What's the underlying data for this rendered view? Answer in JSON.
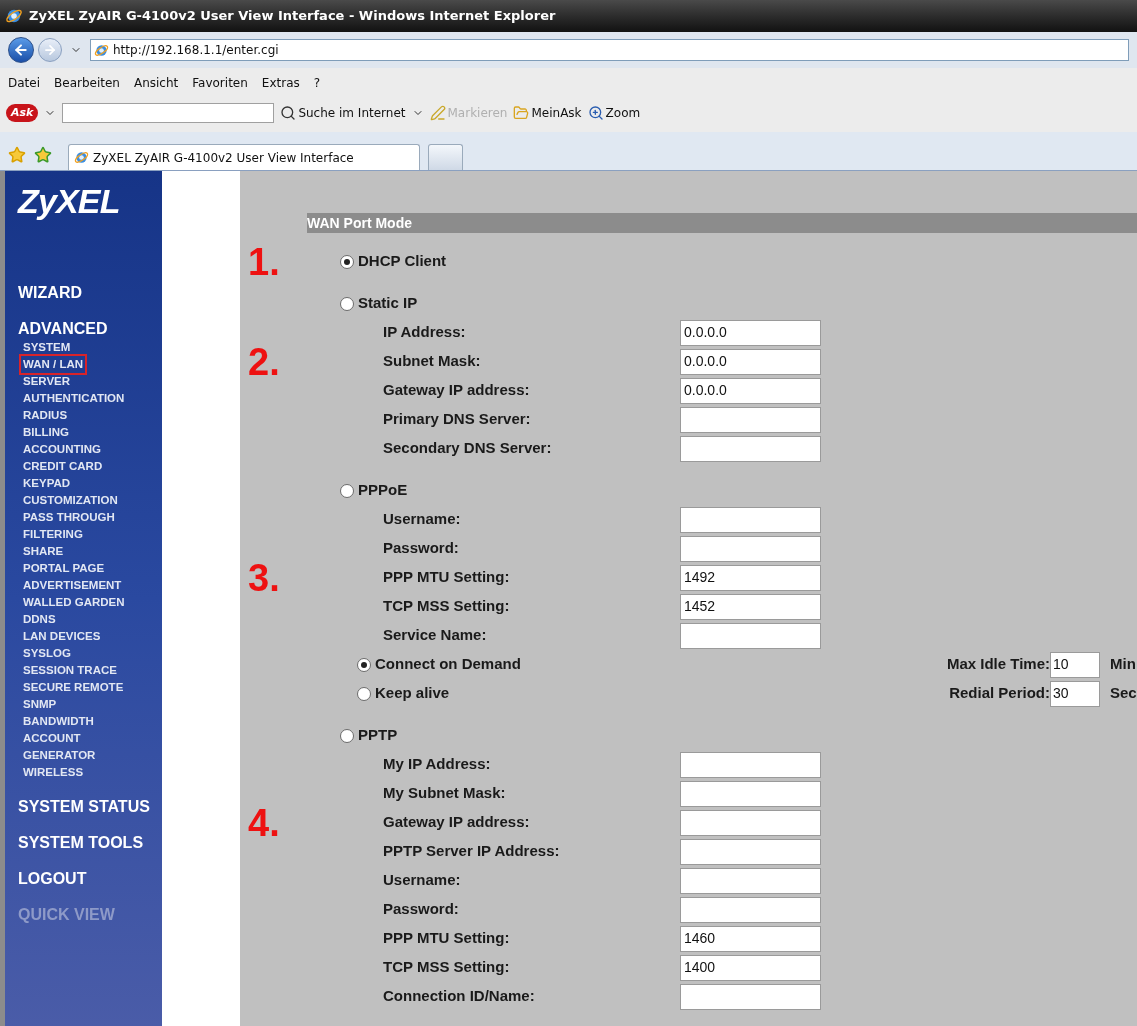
{
  "window": {
    "title": "ZyXEL ZyAIR G-4100v2 User View Interface - Windows Internet Explorer"
  },
  "address_bar": {
    "url": "http://192.168.1.1/enter.cgi"
  },
  "menu": [
    "Datei",
    "Bearbeiten",
    "Ansicht",
    "Favoriten",
    "Extras",
    "?"
  ],
  "ask_toolbar": {
    "logo": "Ask",
    "items": [
      {
        "label": "Suche im Internet",
        "kind": "search",
        "disabled": false
      },
      {
        "label": "Markieren",
        "kind": "pen",
        "disabled": true
      },
      {
        "label": "MeinAsk",
        "kind": "folder",
        "disabled": false
      },
      {
        "label": "Zoom",
        "kind": "zoom",
        "disabled": false
      }
    ]
  },
  "tabs": [
    {
      "label": "ZyXEL ZyAIR G-4100v2 User View Interface",
      "selected": true
    }
  ],
  "sidebar": {
    "logo": "ZyXEL",
    "items": [
      {
        "label": "WIZARD",
        "kind": "heading",
        "selected": false,
        "disabled": false
      },
      {
        "label": "ADVANCED",
        "kind": "heading",
        "selected": false,
        "disabled": false,
        "children": [
          {
            "label": "SYSTEM",
            "selected": false
          },
          {
            "label": "WAN / LAN",
            "selected": true
          },
          {
            "label": "SERVER",
            "selected": false
          },
          {
            "label": "AUTHENTICATION",
            "selected": false
          },
          {
            "label": "RADIUS",
            "selected": false
          },
          {
            "label": "BILLING",
            "selected": false
          },
          {
            "label": "ACCOUNTING",
            "selected": false
          },
          {
            "label": "CREDIT CARD",
            "selected": false
          },
          {
            "label": "KEYPAD",
            "selected": false
          },
          {
            "label": "CUSTOMIZATION",
            "selected": false
          },
          {
            "label": "PASS THROUGH",
            "selected": false
          },
          {
            "label": "FILTERING",
            "selected": false
          },
          {
            "label": "SHARE",
            "selected": false
          },
          {
            "label": "PORTAL PAGE",
            "selected": false
          },
          {
            "label": "ADVERTISEMENT",
            "selected": false
          },
          {
            "label": "WALLED GARDEN",
            "selected": false
          },
          {
            "label": "DDNS",
            "selected": false
          },
          {
            "label": "LAN DEVICES",
            "selected": false
          },
          {
            "label": "SYSLOG",
            "selected": false
          },
          {
            "label": "SESSION TRACE",
            "selected": false
          },
          {
            "label": "SECURE REMOTE",
            "selected": false
          },
          {
            "label": "SNMP",
            "selected": false
          },
          {
            "label": "BANDWIDTH",
            "selected": false
          },
          {
            "label": "ACCOUNT",
            "selected": false
          },
          {
            "label": "GENERATOR",
            "selected": false
          },
          {
            "label": "WIRELESS",
            "selected": false
          }
        ]
      },
      {
        "label": "SYSTEM STATUS",
        "kind": "heading",
        "selected": false,
        "disabled": false
      },
      {
        "label": "SYSTEM TOOLS",
        "kind": "heading",
        "selected": false,
        "disabled": false
      },
      {
        "label": "LOGOUT",
        "kind": "heading",
        "selected": false,
        "disabled": false
      },
      {
        "label": "QUICK VIEW",
        "kind": "heading",
        "selected": false,
        "disabled": true
      }
    ]
  },
  "wan_port_mode": {
    "title": "WAN Port Mode",
    "options": [
      {
        "label": "DHCP Client",
        "selected": true,
        "marker": "1."
      },
      {
        "label": "Static IP",
        "selected": false,
        "fields": [
          {
            "label": "IP Address:",
            "value": "0.0.0.0"
          },
          {
            "label": "Subnet Mask:",
            "value": "0.0.0.0",
            "marker": "2."
          },
          {
            "label": "Gateway IP address:",
            "value": "0.0.0.0"
          },
          {
            "label": "Primary DNS Server:"
          },
          {
            "label": "Secondary DNS Server:"
          }
        ]
      },
      {
        "label": "PPPoE",
        "selected": false,
        "fields": [
          {
            "label": "Username:"
          },
          {
            "label": "Password:"
          },
          {
            "label": "PPP MTU Setting:",
            "value": "1492",
            "marker": "3."
          },
          {
            "label": "TCP MSS Setting:",
            "value": "1452"
          },
          {
            "label": "Service Name:"
          }
        ],
        "connection_modes": [
          {
            "label": "Connect on Demand",
            "selected": true,
            "setting": "Max Idle Time:",
            "value": "10",
            "unit": "Min"
          },
          {
            "label": "Keep alive",
            "selected": false,
            "setting": "Redial Period:",
            "value": "30",
            "unit": "Sec"
          }
        ]
      },
      {
        "label": "PPTP",
        "selected": false,
        "fields": [
          {
            "label": "My IP Address:"
          },
          {
            "label": "My Subnet Mask:"
          },
          {
            "label": "Gateway IP address:",
            "marker": "4."
          },
          {
            "label": "PPTP Server IP Address:"
          },
          {
            "label": "Username:"
          },
          {
            "label": "Password:"
          },
          {
            "label": "PPP MTU Setting:",
            "value": "1460"
          },
          {
            "label": "TCP MSS Setting:",
            "value": "1400"
          },
          {
            "label": "Connection ID/Name:"
          }
        ]
      }
    ]
  }
}
